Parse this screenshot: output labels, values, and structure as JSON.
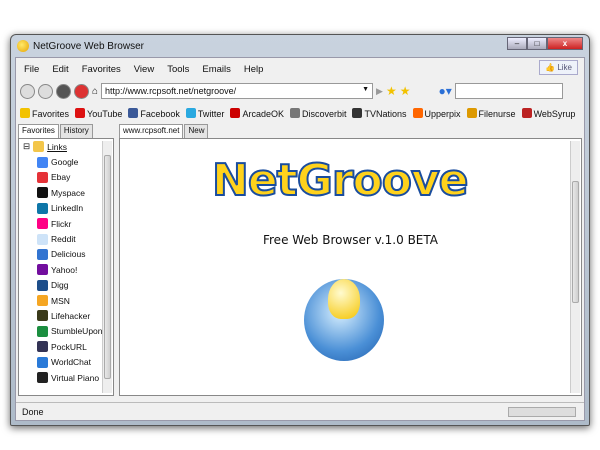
{
  "window": {
    "title": "NetGroove Web Browser"
  },
  "menu": [
    "File",
    "Edit",
    "Favorites",
    "View",
    "Tools",
    "Emails",
    "Help"
  ],
  "like_label": "Like",
  "address": {
    "value": "http://www.rcpsoft.net/netgroove/"
  },
  "search": {
    "value": ""
  },
  "bookmarks": [
    {
      "label": "Favorites",
      "color": "#f2c200"
    },
    {
      "label": "YouTube",
      "color": "#d11"
    },
    {
      "label": "Facebook",
      "color": "#3b5998"
    },
    {
      "label": "Twitter",
      "color": "#2aa9e0"
    },
    {
      "label": "ArcadeOK",
      "color": "#c00"
    },
    {
      "label": "Discoverbit",
      "color": "#777"
    },
    {
      "label": "TVNations",
      "color": "#333"
    },
    {
      "label": "Upperpix",
      "color": "#f60"
    },
    {
      "label": "Filenurse",
      "color": "#d90"
    },
    {
      "label": "WebSyrup",
      "color": "#b22"
    }
  ],
  "sidebar": {
    "tabs": [
      "Favorites",
      "History"
    ],
    "root": "Links",
    "items": [
      {
        "label": "Google",
        "color": "#4285f4"
      },
      {
        "label": "Ebay",
        "color": "#e53238"
      },
      {
        "label": "Myspace",
        "color": "#111"
      },
      {
        "label": "LinkedIn",
        "color": "#0e76a8"
      },
      {
        "label": "Flickr",
        "color": "#ff0084"
      },
      {
        "label": "Reddit",
        "color": "#cee3f8"
      },
      {
        "label": "Delicious",
        "color": "#3274d1"
      },
      {
        "label": "Yahoo!",
        "color": "#720e9e"
      },
      {
        "label": "Digg",
        "color": "#1d4e8a"
      },
      {
        "label": "MSN",
        "color": "#f5a623"
      },
      {
        "label": "Lifehacker",
        "color": "#3a3a1a"
      },
      {
        "label": "StumbleUpon",
        "color": "#1b8e3f"
      },
      {
        "label": "PockURL",
        "color": "#335"
      },
      {
        "label": "WorldChat",
        "color": "#2a7ad8"
      },
      {
        "label": "Virtual Piano",
        "color": "#222"
      }
    ]
  },
  "browser_tabs": [
    "www.rcpsoft.net",
    "New"
  ],
  "page": {
    "logo": "NetGroove",
    "subtitle": "Free Web Browser v.1.0 BETA"
  },
  "status": "Done"
}
